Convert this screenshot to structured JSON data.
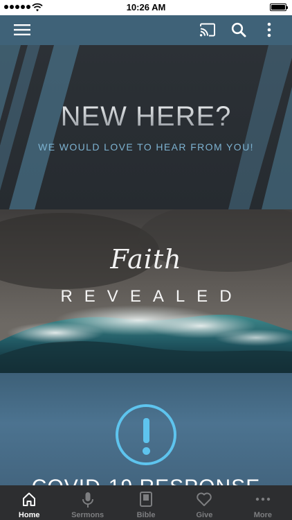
{
  "status_bar": {
    "time": "10:26 AM"
  },
  "app_bar": {
    "icons": [
      "menu-icon",
      "cast-icon",
      "search-icon",
      "more-vertical-icon"
    ]
  },
  "banners": [
    {
      "title": "NEW HERE?",
      "subtitle": "WE WOULD LOVE TO HEAR FROM YOU!"
    },
    {
      "script_word": "Faith",
      "word": "REVEALED"
    },
    {
      "icon": "exclamation-circle-icon",
      "title": "COVID-19 RESPONSE"
    }
  ],
  "tabs": [
    {
      "label": "Home",
      "icon": "home-icon",
      "active": true
    },
    {
      "label": "Sermons",
      "icon": "microphone-icon",
      "active": false
    },
    {
      "label": "Bible",
      "icon": "bible-icon",
      "active": false
    },
    {
      "label": "Give",
      "icon": "heart-icon",
      "active": false
    },
    {
      "label": "More",
      "icon": "more-horizontal-icon",
      "active": false
    }
  ],
  "colors": {
    "app_bar": "#3f6278",
    "accent_blue": "#5ec4ee",
    "tab_bar": "#2d2e30",
    "tab_inactive": "#7d7e80",
    "tab_active": "#ffffff"
  }
}
